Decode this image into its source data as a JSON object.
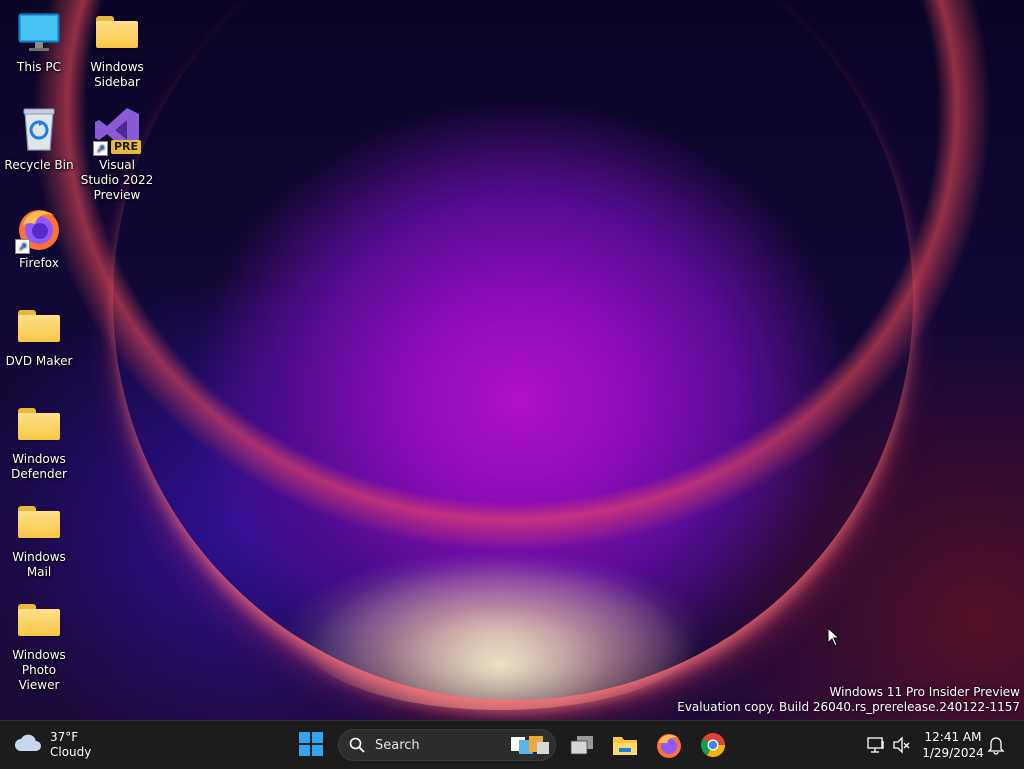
{
  "desktop": {
    "icons": [
      {
        "label": "This PC",
        "icon": "monitor-icon"
      },
      {
        "label": "Windows Sidebar",
        "icon": "folder-icon"
      },
      {
        "label": "Recycle Bin",
        "icon": "recycle-bin-icon"
      },
      {
        "label": "Visual Studio 2022 Preview",
        "icon": "visual-studio-icon",
        "badge": "PRE"
      },
      {
        "label": "Firefox",
        "icon": "firefox-icon"
      },
      {
        "label": "DVD Maker",
        "icon": "folder-icon"
      },
      {
        "label": "Windows Defender",
        "icon": "folder-icon"
      },
      {
        "label": "Windows Mail",
        "icon": "folder-icon"
      },
      {
        "label": "Windows Photo Viewer",
        "icon": "folder-icon"
      }
    ],
    "watermark": {
      "line1": "Windows 11 Pro Insider Preview",
      "line2": "Evaluation copy. Build 26040.rs_prerelease.240122-1157"
    }
  },
  "taskbar": {
    "weather": {
      "temp": "37°F",
      "condition": "Cloudy",
      "icon": "cloud-icon"
    },
    "search": {
      "label": "Search"
    },
    "pinned": [
      "start-icon",
      "task-view-icon",
      "file-explorer-icon",
      "firefox-icon",
      "chrome-icon"
    ],
    "tray": {
      "network_icon": "network-icon",
      "volume_icon": "volume-muted-icon",
      "notification_icon": "bell-icon"
    },
    "clock": {
      "time": "12:41 AM",
      "date": "1/29/2024"
    }
  },
  "colors": {
    "taskbar": "#1c1c1c",
    "accent": "#0078d4",
    "folder": "#f6c644"
  }
}
